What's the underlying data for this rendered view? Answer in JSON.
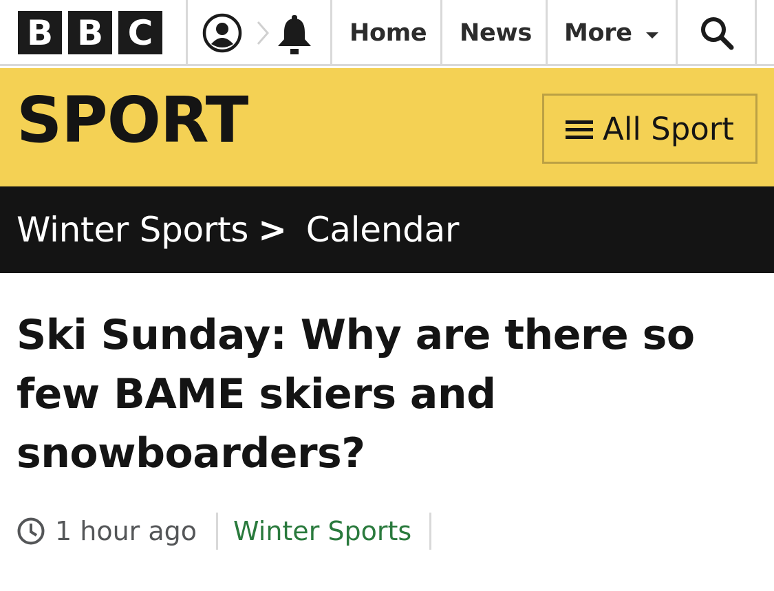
{
  "nav": {
    "logo_letters": [
      "B",
      "B",
      "C"
    ],
    "account_icon": "account-icon",
    "notifications_icon": "bell-icon",
    "home": "Home",
    "news": "News",
    "more": "More",
    "search_icon": "search-icon"
  },
  "sport_header": {
    "title": "SPORT",
    "all_sport_label": "All Sport",
    "band_color": "#f4d154"
  },
  "breadcrumb": {
    "parent": "Winter Sports",
    "separator": ">",
    "current": "Calendar"
  },
  "article": {
    "headline": "Ski Sunday: Why are there so few BAME skiers and snowboarders?",
    "time": "1 hour ago",
    "section": "Winter Sports",
    "section_color": "#2a7a3d"
  }
}
